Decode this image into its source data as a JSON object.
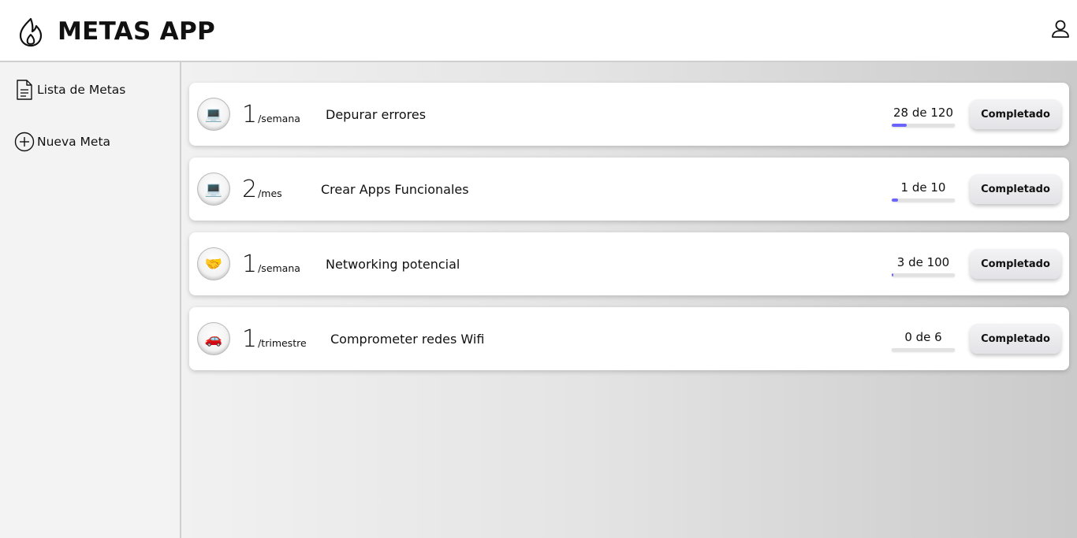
{
  "header": {
    "title": "METAS APP",
    "logo_icon": "flame-icon",
    "profile_icon": "user-icon"
  },
  "sidebar": {
    "items": [
      {
        "label": "Lista de Metas",
        "icon": "document-icon"
      },
      {
        "label": "Nueva Meta",
        "icon": "plus-circle-icon"
      }
    ]
  },
  "goals": [
    {
      "icon": "💻",
      "icon_name": "laptop-icon",
      "count": "1",
      "period": "/semana",
      "name": "Depurar errores",
      "progress_text": "28 de 120",
      "progress": 0.233,
      "button": "Completado"
    },
    {
      "icon": "💻",
      "icon_name": "laptop-icon",
      "count": "2",
      "period": "/mes",
      "name": "Crear Apps Funcionales",
      "progress_text": "1 de 10",
      "progress": 0.1,
      "button": "Completado"
    },
    {
      "icon": "🤝",
      "icon_name": "handshake-icon",
      "count": "1",
      "period": "/semana",
      "name": "Networking potencial",
      "progress_text": "3 de 100",
      "progress": 0.03,
      "button": "Completado"
    },
    {
      "icon": "🚗",
      "icon_name": "car-icon",
      "count": "1",
      "period": "/trimestre",
      "name": "Comprometer redes Wifi",
      "progress_text": "0 de 6",
      "progress": 0,
      "button": "Completado"
    }
  ],
  "colors": {
    "accent": "#6b63ff",
    "sidebar_bg": "#f3f3f3",
    "border": "#cfcfcf"
  }
}
